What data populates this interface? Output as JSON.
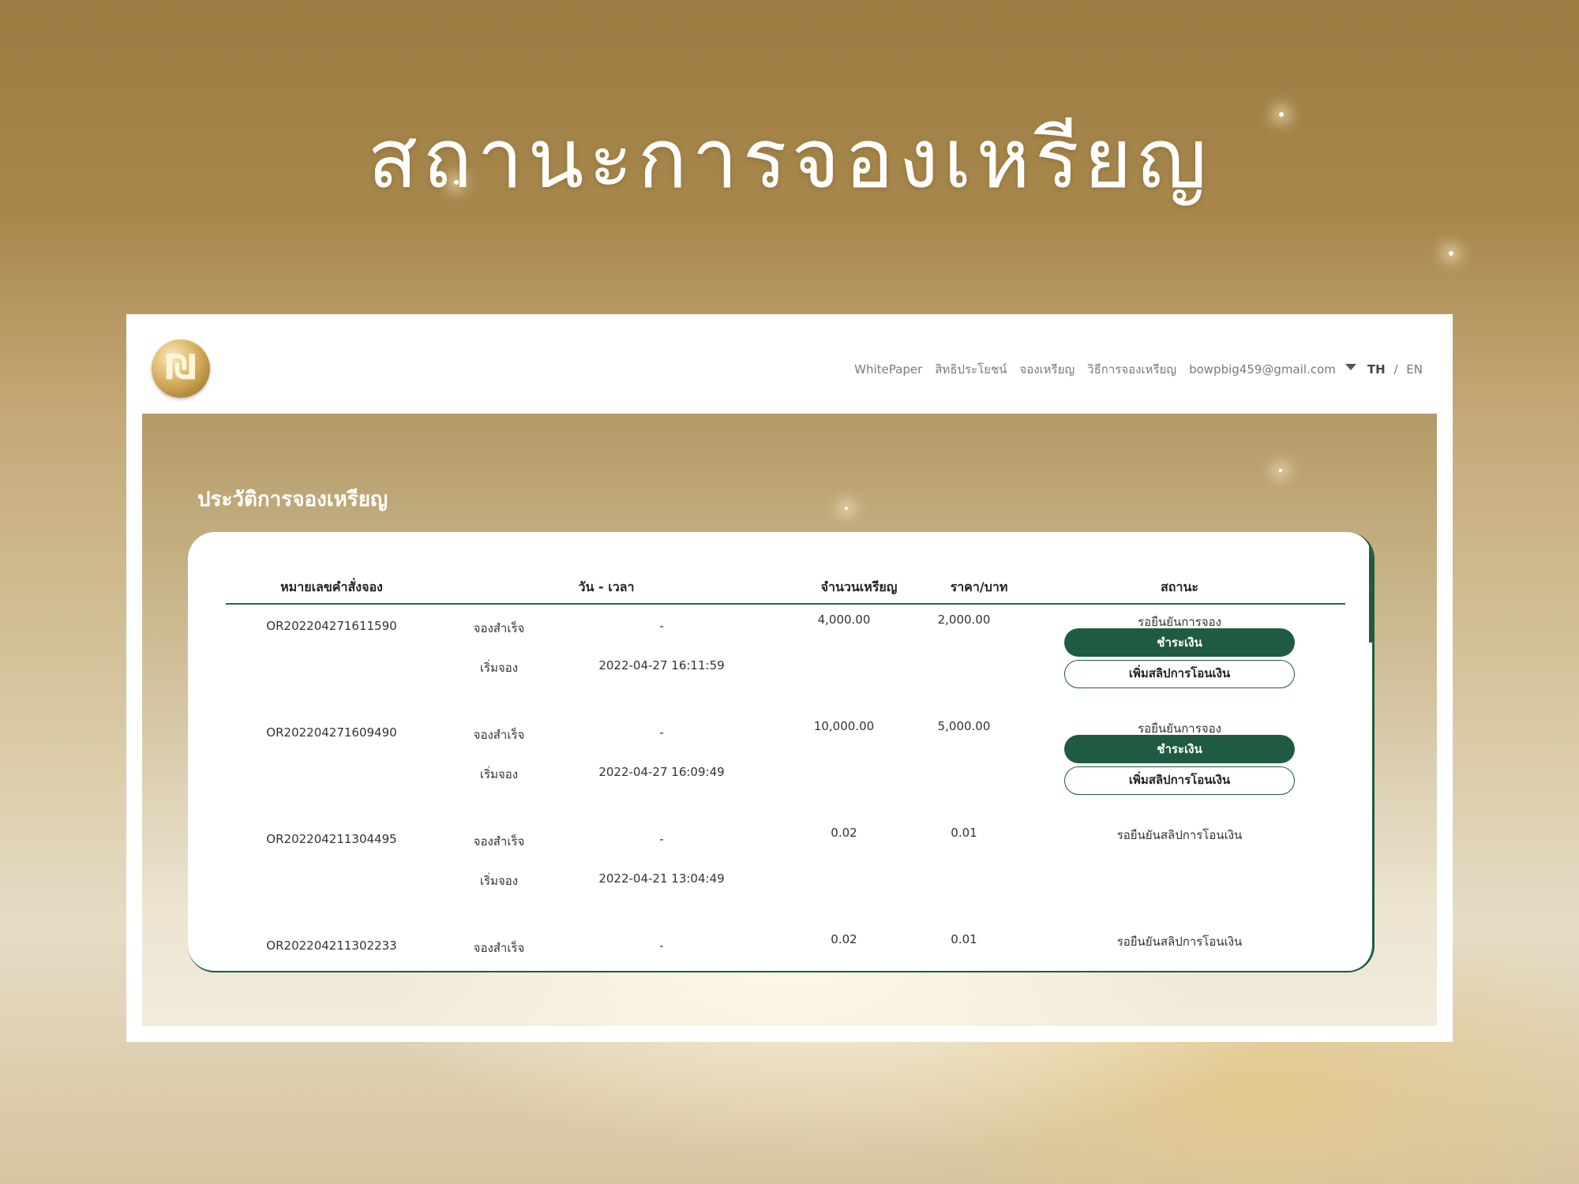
{
  "slide": {
    "title": "สถานะการจองเหรียญ"
  },
  "nav": {
    "links": [
      "WhitePaper",
      "สิทธิประโยชน์",
      "จองเหรียญ",
      "วิธีการจองเหรียญ"
    ],
    "user_email": "bowpbig459@gmail.com",
    "lang_th": "TH",
    "lang_sep": "/",
    "lang_en": "EN"
  },
  "section": {
    "title": "ประวัติการจองเหรียญ"
  },
  "table": {
    "headers": {
      "order_no": "หมายเลขคำสั่งจอง",
      "datetime": "วัน - เวลา",
      "coins": "จำนวนเหรียญ",
      "price": "ราคา/บาท",
      "status": "สถานะ"
    },
    "rows": [
      {
        "order_no": "OR202204271611590",
        "step1_label": "จองสำเร็จ",
        "step1_time": "-",
        "step2_label": "เริ่มจอง",
        "step2_time": "2022-04-27 16:11:59",
        "coins": "4,000.00",
        "price": "2,000.00",
        "status": "รอยืนยันการจอง",
        "pay_label": "ชำระเงิน",
        "slip_label": "เพิ่มสลิปการโอนเงิน"
      },
      {
        "order_no": "OR202204271609490",
        "step1_label": "จองสำเร็จ",
        "step1_time": "-",
        "step2_label": "เริ่มจอง",
        "step2_time": "2022-04-27 16:09:49",
        "coins": "10,000.00",
        "price": "5,000.00",
        "status": "รอยืนยันการจอง",
        "pay_label": "ชำระเงิน",
        "slip_label": "เพิ่มสลิปการโอนเงิน"
      },
      {
        "order_no": "OR202204211304495",
        "step1_label": "จองสำเร็จ",
        "step1_time": "-",
        "step2_label": "เริ่มจอง",
        "step2_time": "2022-04-21 13:04:49",
        "coins": "0.02",
        "price": "0.01",
        "status": "รอยืนยันสลิปการโอนเงิน"
      },
      {
        "order_no": "OR202204211302233",
        "step1_label": "จองสำเร็จ",
        "step1_time": "-",
        "coins": "0.02",
        "price": "0.01",
        "status": "รอยืนยันสลิปการโอนเงิน"
      }
    ]
  }
}
